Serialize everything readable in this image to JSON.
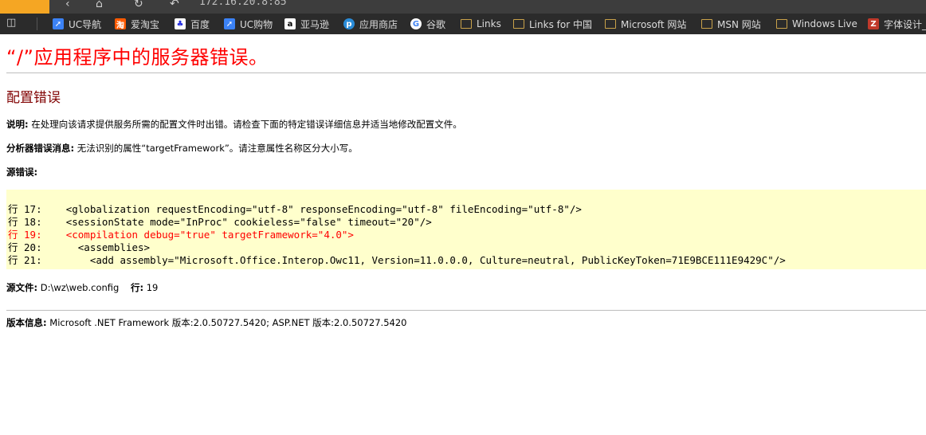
{
  "browser": {
    "url": "172.16.20.8:85",
    "bookmarks": [
      {
        "icon": "cursor-icon",
        "label": "UC导航"
      },
      {
        "icon": "taobao-icon",
        "label": "爱淘宝"
      },
      {
        "icon": "baidu-icon",
        "label": "百度"
      },
      {
        "icon": "cursor-icon",
        "label": "UC购物"
      },
      {
        "icon": "amazon-icon",
        "label": "亚马逊"
      },
      {
        "icon": "app-store-icon",
        "label": "应用商店"
      },
      {
        "icon": "google-icon",
        "label": "谷歌"
      },
      {
        "icon": "folder-icon",
        "label": "Links"
      },
      {
        "icon": "folder-icon",
        "label": "Links for 中国"
      },
      {
        "icon": "folder-icon",
        "label": "Microsoft 网站"
      },
      {
        "icon": "folder-icon",
        "label": "MSN 网站"
      },
      {
        "icon": "folder-icon",
        "label": "Windows Live"
      },
      {
        "icon": "z-icon",
        "label": "字体设计_"
      }
    ]
  },
  "page": {
    "title": "“/”应用程序中的服务器错误。",
    "subtitle": "配置错误",
    "desc_label": "说明:",
    "desc_text": "在处理向该请求提供服务所需的配置文件时出错。请检查下面的特定错误详细信息并适当地修改配置文件。",
    "parser_label": "分析器错误消息:",
    "parser_text": "无法识别的属性“targetFramework”。请注意属性名称区分大小写。",
    "source_error_label": "源错误:",
    "code_lines": [
      {
        "num": "行 17:",
        "text": "    <globalization requestEncoding=\"utf-8\" responseEncoding=\"utf-8\" fileEncoding=\"utf-8\"/>",
        "highlight": false
      },
      {
        "num": "行 18:",
        "text": "    <sessionState mode=\"InProc\" cookieless=\"false\" timeout=\"20\"/>",
        "highlight": false
      },
      {
        "num": "行 19:",
        "text": "    <compilation debug=\"true\" targetFramework=\"4.0\">",
        "highlight": true
      },
      {
        "num": "行 20:",
        "text": "      <assemblies>",
        "highlight": false
      },
      {
        "num": "行 21:",
        "text": "        <add assembly=\"Microsoft.Office.Interop.Owc11, Version=11.0.0.0, Culture=neutral, PublicKeyToken=71E9BCE111E9429C\"/>",
        "highlight": false
      }
    ],
    "source_file_label": "源文件:",
    "source_file_value": "D:\\wz\\web.config",
    "line_label": "行:",
    "line_value": "19",
    "version_label": "版本信息:",
    "version_text": "Microsoft .NET Framework 版本:2.0.50727.5420; ASP.NET 版本:2.0.50727.5420"
  }
}
